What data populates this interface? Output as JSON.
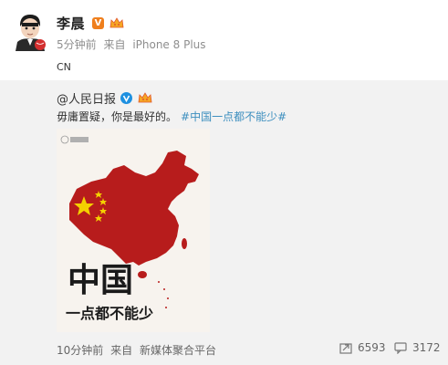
{
  "post": {
    "author": "李晨",
    "verified_badge": "V",
    "time": "5分钟前",
    "source_prefix": "来自",
    "source": "iPhone 8 Plus",
    "text": "CN",
    "badge_color": "#ef7f1d"
  },
  "repost": {
    "author": "@人民日报",
    "text": "毋庸置疑，你是最好的。",
    "hashtag": "#中国一点都不能少#",
    "hashtag_color": "#3d8fbf",
    "image": {
      "title_large": "中国",
      "subtitle": "一点都不能少",
      "map_color": "#b71c1c"
    },
    "time": "10分钟前",
    "source_prefix": "来自",
    "source": "新媒体聚合平台",
    "repost_count": "6593",
    "comment_count": "3172"
  }
}
